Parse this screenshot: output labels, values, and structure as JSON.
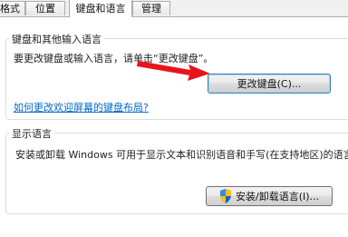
{
  "tabs": [
    {
      "label": "格式",
      "active": false
    },
    {
      "label": "位置",
      "active": false
    },
    {
      "label": "键盘和语言",
      "active": true
    },
    {
      "label": "管理",
      "active": false
    }
  ],
  "keyboard_group": {
    "title": "键盘和其他输入语言",
    "description": "要更改键盘或输入语言，请单击“更改键盘”。",
    "change_keyboard_button": "更改键盘(C)...",
    "link": "如何更改欢迎屏幕的键盘布局?"
  },
  "display_group": {
    "title": "显示语言",
    "description": "安装或卸载 Windows 可用于显示文本和识别语音和手写(在支持地区)的语言。",
    "install_button": "安装/卸载语言(I)..."
  },
  "colors": {
    "annotation_arrow": "#e8141a",
    "link": "#0066cc"
  },
  "icons": {
    "install_button_icon": "uac-shield-icon",
    "annotation": "red-arrow-annotation"
  }
}
